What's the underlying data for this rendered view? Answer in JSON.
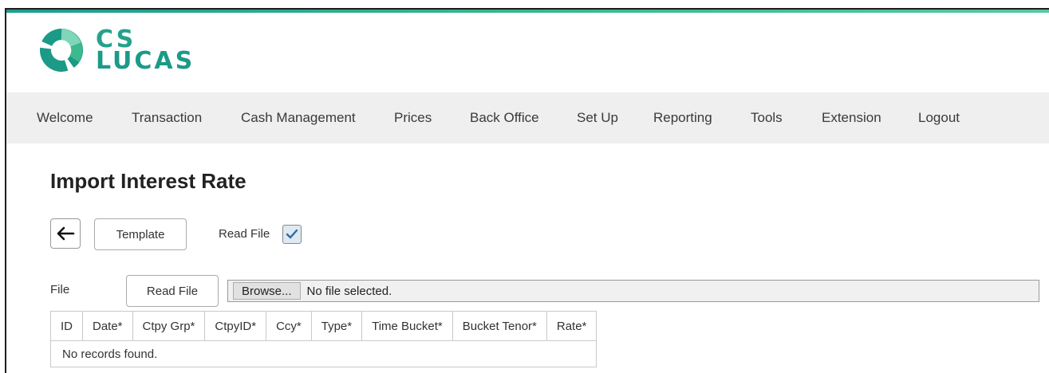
{
  "brand": {
    "line1": "CS",
    "line2": "LUCAS",
    "colors": {
      "primary": "#1b9a88",
      "accent": "#56c7a4"
    }
  },
  "nav": {
    "items": [
      {
        "label": "Welcome"
      },
      {
        "label": "Transaction"
      },
      {
        "label": "Cash Management"
      },
      {
        "label": "Prices"
      },
      {
        "label": "Back Office"
      },
      {
        "label": "Set Up"
      },
      {
        "label": "Reporting"
      },
      {
        "label": "Tools"
      },
      {
        "label": "Extension"
      },
      {
        "label": "Logout"
      }
    ]
  },
  "page": {
    "title": "Import Interest Rate"
  },
  "toolbar": {
    "back_icon": "arrow-left-icon",
    "template_label": "Template",
    "read_file_label": "Read File",
    "read_file_checked": true
  },
  "file": {
    "label": "File",
    "read_file_button": "Read File",
    "browse_label": "Browse...",
    "status": "No file selected."
  },
  "table": {
    "columns": [
      "ID",
      "Date*",
      "Ctpy Grp*",
      "CtpyID*",
      "Ccy*",
      "Type*",
      "Time Bucket*",
      "Bucket Tenor*",
      "Rate*"
    ],
    "empty_message": "No records found."
  }
}
